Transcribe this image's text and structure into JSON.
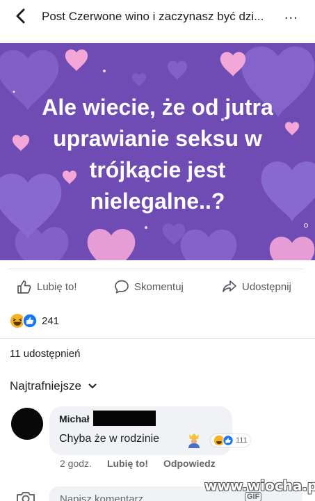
{
  "header": {
    "title": "Post Czerwone wino i zaczynasz być dzi...",
    "more_glyph": "..."
  },
  "post": {
    "background_color": "#6f4bb4",
    "text_lines": [
      "Ale wiecie, że od jutra",
      "uprawianie seksu w",
      "trójkącie jest",
      "nielegalne..?"
    ]
  },
  "actions": {
    "like_label": "Lubię to!",
    "comment_label": "Skomentuj",
    "share_label": "Udostępnij"
  },
  "reactions": {
    "icons": [
      "haha-icon",
      "like-icon"
    ],
    "count": "241"
  },
  "shares": "11 udostępnień",
  "comments_sort": {
    "label": "Najtrafniejsze"
  },
  "comment": {
    "author": "Michał",
    "text": "Chyba że w rodzinie",
    "emoji": "person-crown-emoji",
    "reaction_count": "111",
    "time": "2 godz.",
    "like_label": "Lubię to!",
    "reply_label": "Odpowiedz"
  },
  "composer": {
    "placeholder": "Napisz komentarz...",
    "gif_label": "GIF"
  },
  "watermark": "www.wiocha.pl",
  "colors": {
    "accent_blue": "#1877f2",
    "haha_yellow": "#f7b125",
    "heart_pink": "#f3a6d8"
  }
}
